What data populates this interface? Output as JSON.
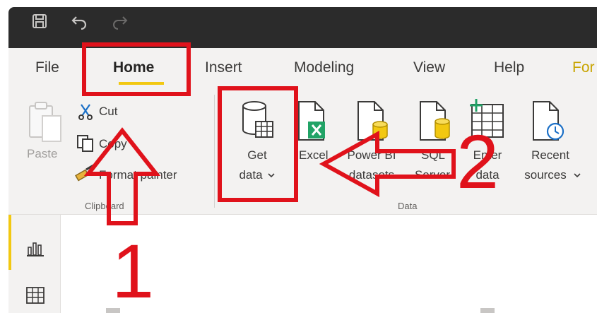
{
  "quick_access": {
    "save_icon": "save-icon",
    "undo_icon": "undo-icon",
    "redo_icon": "redo-icon"
  },
  "tabs": [
    {
      "label": "File"
    },
    {
      "label": "Home"
    },
    {
      "label": "Insert"
    },
    {
      "label": "Modeling"
    },
    {
      "label": "View"
    },
    {
      "label": "Help"
    },
    {
      "label": "For"
    }
  ],
  "ribbon": {
    "clipboard": {
      "paste": "Paste",
      "cut": "Cut",
      "copy": "Copy",
      "format_painter": "Format painter",
      "group_label": "Clipboard"
    },
    "data": {
      "get_data_line1": "Get",
      "get_data_line2": "data",
      "excel": "Excel",
      "power_bi_line1": "Power BI",
      "power_bi_line2": "datasets",
      "sql_line1": "SQL",
      "sql_line2": "Server",
      "enter_line1": "Enter",
      "enter_line2": "data",
      "recent_line1": "Recent",
      "recent_line2": "sources",
      "group_label": "Data"
    }
  },
  "annotations": {
    "step1": "1",
    "step2": "2"
  },
  "colors": {
    "annotation_red": "#e0121b",
    "accent_yellow": "#f2c811",
    "excel_green": "#21a366",
    "titlebar": "#2b2b2b"
  }
}
